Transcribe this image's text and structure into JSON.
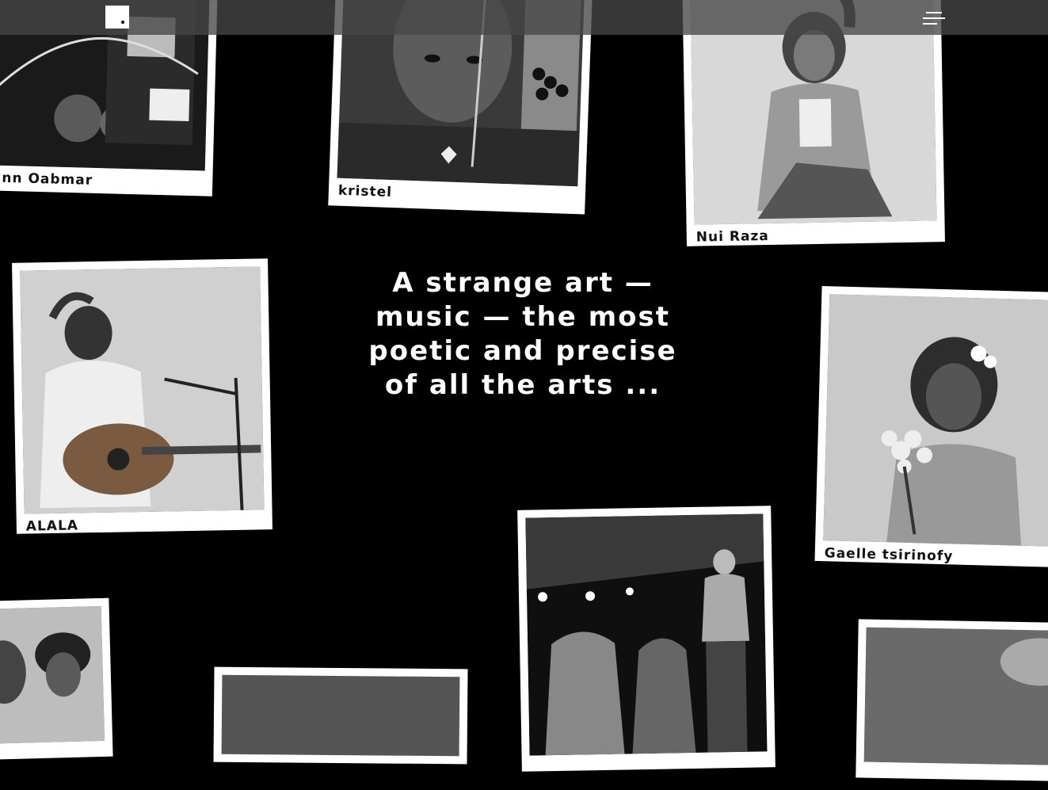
{
  "header": {
    "logo_label": "logo",
    "menu_label": "menu"
  },
  "quote": "A strange art —\nmusic — the most\npoetic and precise\nof all the arts ...",
  "artists": [
    {
      "name": "nn Oabmar"
    },
    {
      "name": "kristel"
    },
    {
      "name": "Nui Raza"
    },
    {
      "name": "ALALA"
    },
    {
      "name": "Gaelle tsirinofy"
    },
    {
      "name": ""
    },
    {
      "name": ""
    },
    {
      "name": ""
    },
    {
      "name": ""
    }
  ]
}
